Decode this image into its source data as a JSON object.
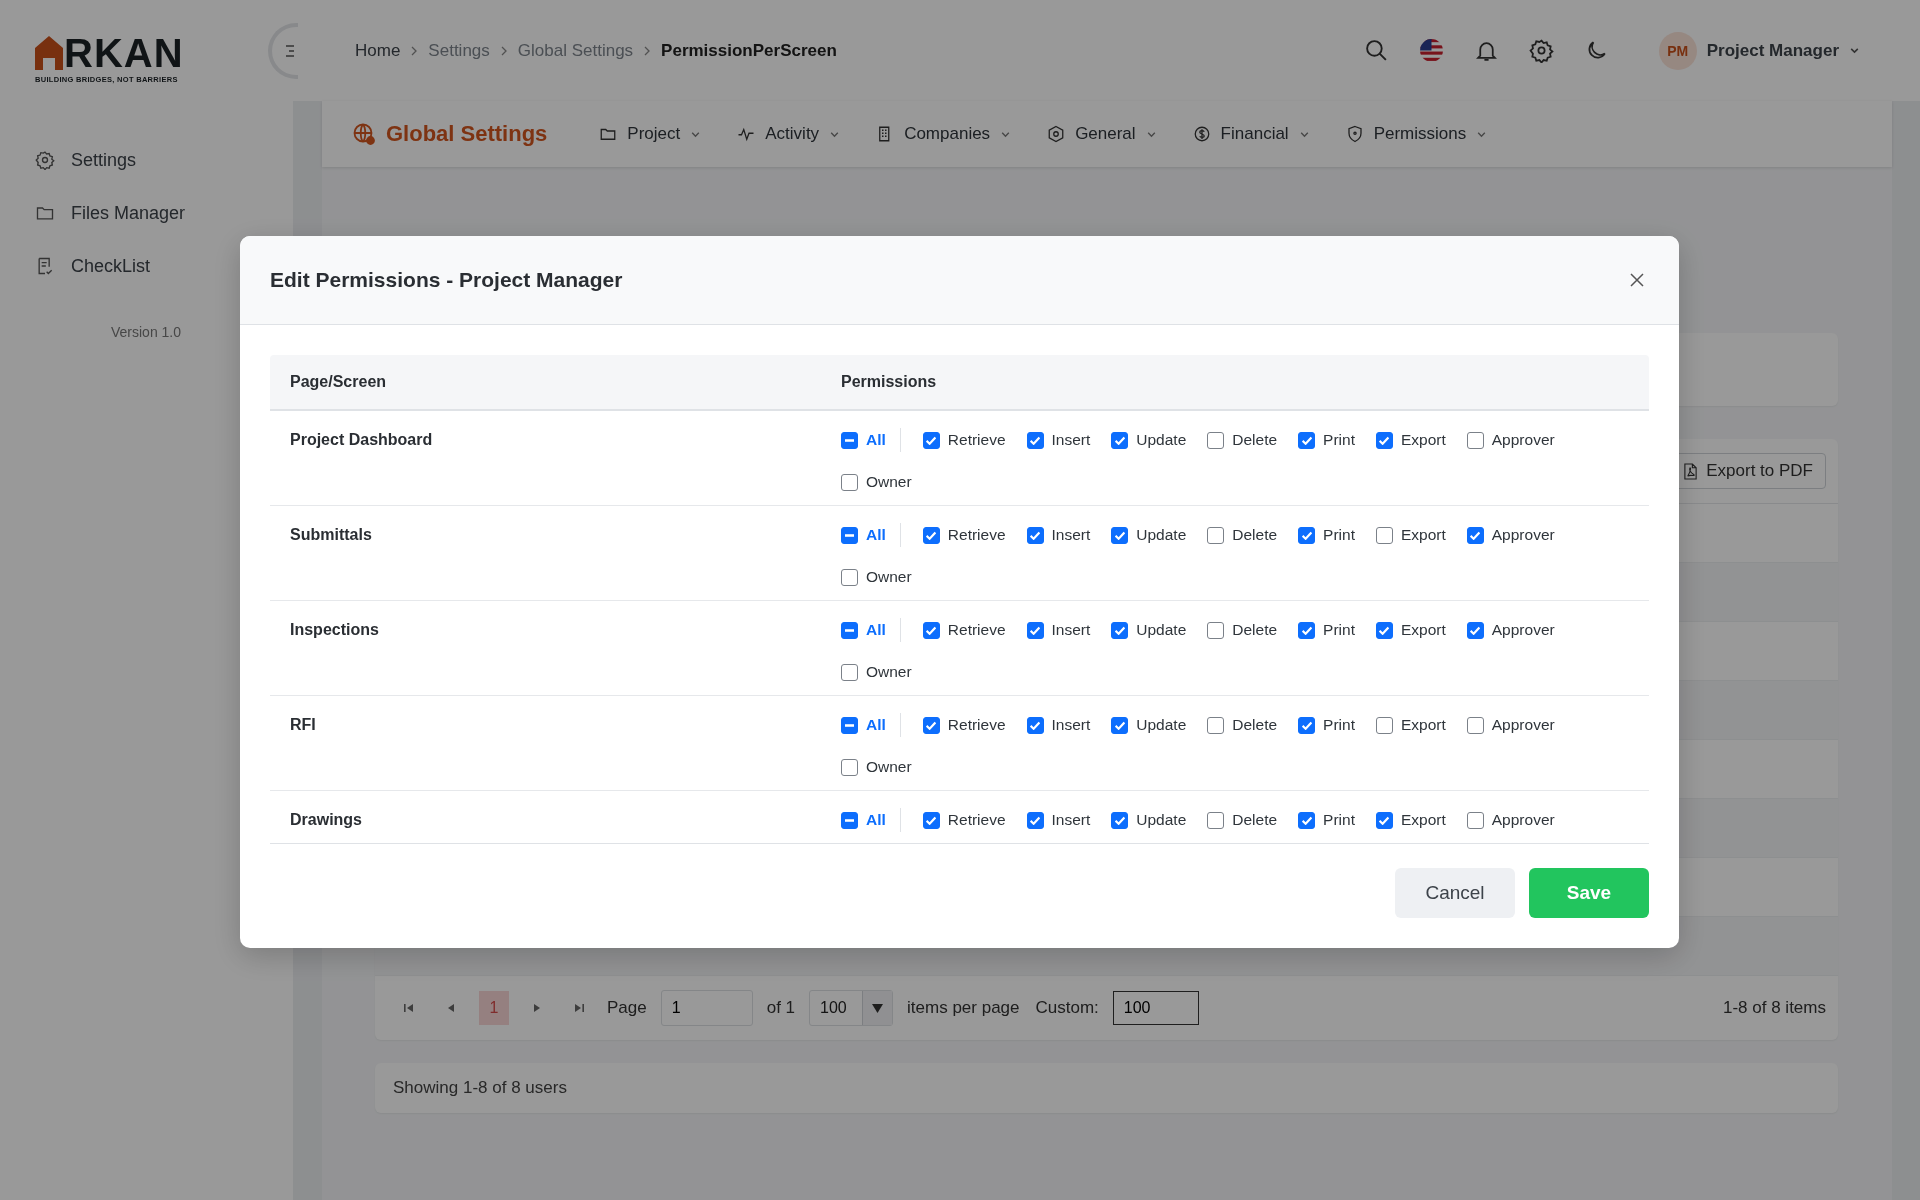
{
  "sidebar": {
    "logo": {
      "name": "RKAN",
      "tagline": "BUILDING BRIDGES, NOT BARRIERS"
    },
    "items": [
      {
        "label": "Settings"
      },
      {
        "label": "Files Manager"
      },
      {
        "label": "CheckList"
      }
    ],
    "version": "Version 1.0"
  },
  "breadcrumb": [
    {
      "label": "Home",
      "current": false
    },
    {
      "label": "Settings",
      "current": false
    },
    {
      "label": "Global Settings",
      "current": false
    },
    {
      "label": "PermissionPerScreen",
      "current": true
    }
  ],
  "user": {
    "initials": "PM",
    "name": "Project Manager"
  },
  "nav": {
    "title": "Global Settings",
    "menus": [
      {
        "label": "Project"
      },
      {
        "label": "Activity"
      },
      {
        "label": "Companies"
      },
      {
        "label": "General"
      },
      {
        "label": "Financial"
      },
      {
        "label": "Permissions"
      }
    ]
  },
  "page": {
    "export_button": "Export to PDF",
    "pagination": {
      "pages": [
        {
          "label": "1",
          "selected": true
        }
      ],
      "page_label": "Page",
      "page_value": "1",
      "of": "of 1",
      "per_page": "100",
      "per_page_label": "items per page",
      "custom_label": "Custom:",
      "custom_value": "100",
      "summary": "1-8 of 8 items"
    },
    "footer": "Showing 1-8 of 8 users"
  },
  "modal": {
    "title": "Edit Permissions - Project Manager",
    "columns": [
      "Page/Screen",
      "Permissions"
    ],
    "rows": [
      {
        "name": "Project Dashboard",
        "permissions": [
          {
            "label": "All",
            "kind": "all",
            "indeterminate": true
          },
          {
            "label": "Retrieve",
            "kind": "option",
            "checked": true
          },
          {
            "label": "Insert",
            "kind": "option",
            "checked": true
          },
          {
            "label": "Update",
            "kind": "option",
            "checked": true
          },
          {
            "label": "Delete",
            "kind": "option",
            "checked": false
          },
          {
            "label": "Print",
            "kind": "option",
            "checked": true
          },
          {
            "label": "Export",
            "kind": "option",
            "checked": true
          },
          {
            "label": "Approver",
            "kind": "option",
            "checked": false
          },
          {
            "label": "Owner",
            "kind": "option",
            "checked": false
          }
        ]
      },
      {
        "name": "Submittals",
        "permissions": [
          {
            "label": "All",
            "kind": "all",
            "indeterminate": true
          },
          {
            "label": "Retrieve",
            "kind": "option",
            "checked": true
          },
          {
            "label": "Insert",
            "kind": "option",
            "checked": true
          },
          {
            "label": "Update",
            "kind": "option",
            "checked": true
          },
          {
            "label": "Delete",
            "kind": "option",
            "checked": false
          },
          {
            "label": "Print",
            "kind": "option",
            "checked": true
          },
          {
            "label": "Export",
            "kind": "option",
            "checked": false
          },
          {
            "label": "Approver",
            "kind": "option",
            "checked": true
          },
          {
            "label": "Owner",
            "kind": "option",
            "checked": false
          }
        ]
      },
      {
        "name": "Inspections",
        "permissions": [
          {
            "label": "All",
            "kind": "all",
            "indeterminate": true
          },
          {
            "label": "Retrieve",
            "kind": "option",
            "checked": true
          },
          {
            "label": "Insert",
            "kind": "option",
            "checked": true
          },
          {
            "label": "Update",
            "kind": "option",
            "checked": true
          },
          {
            "label": "Delete",
            "kind": "option",
            "checked": false
          },
          {
            "label": "Print",
            "kind": "option",
            "checked": true
          },
          {
            "label": "Export",
            "kind": "option",
            "checked": true
          },
          {
            "label": "Approver",
            "kind": "option",
            "checked": true
          },
          {
            "label": "Owner",
            "kind": "option",
            "checked": false
          }
        ]
      },
      {
        "name": "RFI",
        "permissions": [
          {
            "label": "All",
            "kind": "all",
            "indeterminate": true
          },
          {
            "label": "Retrieve",
            "kind": "option",
            "checked": true
          },
          {
            "label": "Insert",
            "kind": "option",
            "checked": true
          },
          {
            "label": "Update",
            "kind": "option",
            "checked": true
          },
          {
            "label": "Delete",
            "kind": "option",
            "checked": false
          },
          {
            "label": "Print",
            "kind": "option",
            "checked": true
          },
          {
            "label": "Export",
            "kind": "option",
            "checked": false
          },
          {
            "label": "Approver",
            "kind": "option",
            "checked": false
          },
          {
            "label": "Owner",
            "kind": "option",
            "checked": false
          }
        ]
      },
      {
        "name": "Drawings",
        "permissions": [
          {
            "label": "All",
            "kind": "all",
            "indeterminate": true
          },
          {
            "label": "Retrieve",
            "kind": "option",
            "checked": true
          },
          {
            "label": "Insert",
            "kind": "option",
            "checked": true
          },
          {
            "label": "Update",
            "kind": "option",
            "checked": true
          },
          {
            "label": "Delete",
            "kind": "option",
            "checked": false
          },
          {
            "label": "Print",
            "kind": "option",
            "checked": true
          },
          {
            "label": "Export",
            "kind": "option",
            "checked": true
          },
          {
            "label": "Approver",
            "kind": "option",
            "checked": false
          }
        ]
      }
    ],
    "buttons": [
      {
        "label": "Cancel",
        "kind": "secondary"
      },
      {
        "label": "Save",
        "kind": "primary"
      }
    ]
  }
}
